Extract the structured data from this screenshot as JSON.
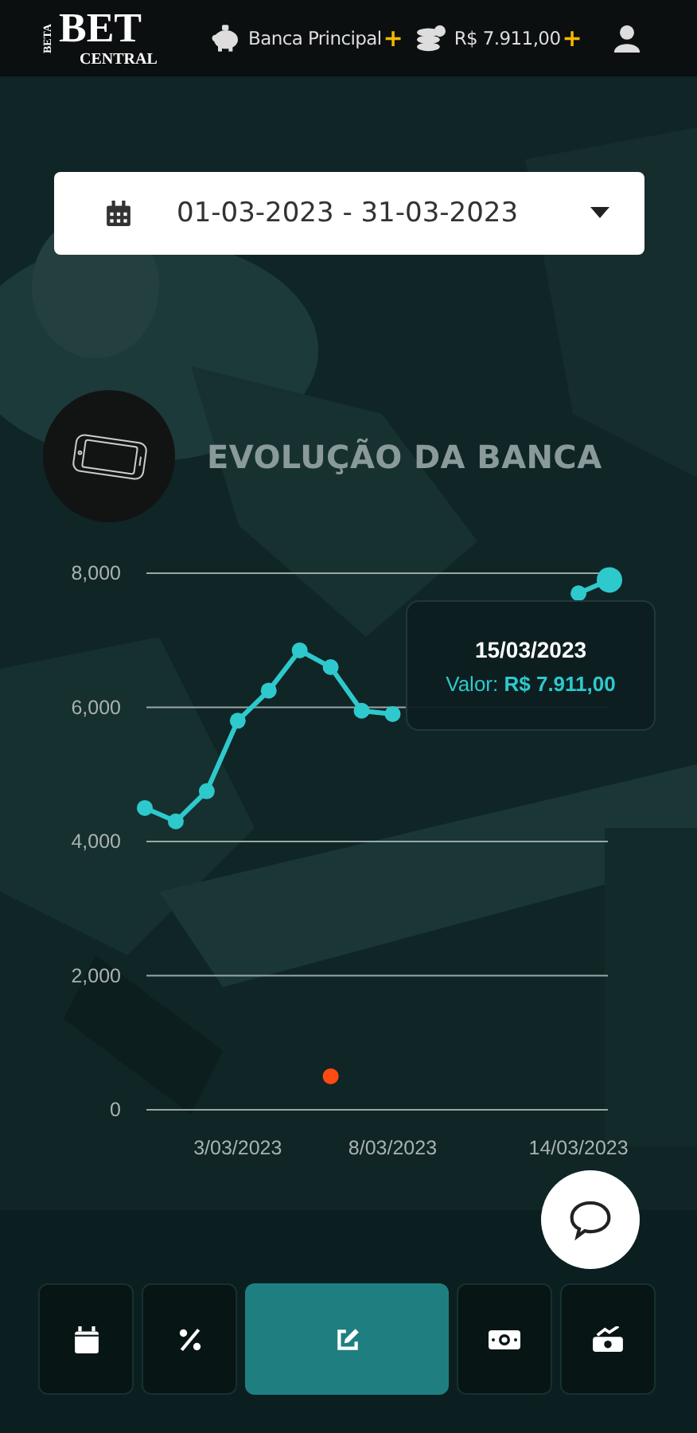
{
  "header": {
    "logo": {
      "small": "BETA",
      "main": "BET",
      "sub": "CENTRAL"
    },
    "bank": "Banca Principal",
    "bank_add": "+",
    "balance": "R$ 7.911,00",
    "balance_add": "+"
  },
  "date_range": {
    "value": "01-03-2023 - 31-03-2023"
  },
  "section_title": "EVOLUÇÃO DA BANCA",
  "chart": {
    "chart_data": {
      "type": "line",
      "categories": [
        null,
        null,
        null,
        "3/03/2023",
        null,
        null,
        null,
        null,
        "8/03/2023",
        null,
        null,
        null,
        null,
        null,
        "14/03/2023",
        null
      ],
      "grid": true,
      "series": [
        {
          "color": "#2ec9cc",
          "marker": true,
          "values": [
            4500,
            4300,
            4750,
            5800,
            6250,
            6850,
            6600,
            5950,
            5900,
            null,
            null,
            null,
            null,
            null,
            7700,
            7900
          ]
        },
        {
          "color": "#ff4a12",
          "marker": true,
          "values": [
            null,
            null,
            null,
            null,
            null,
            null,
            500,
            null,
            null,
            null,
            null,
            null,
            null,
            null,
            null,
            null
          ]
        }
      ],
      "ylim": [
        0,
        8000
      ],
      "yticks": [
        {
          "value": 0,
          "label": "0"
        },
        {
          "value": 2000,
          "label": "2,000"
        },
        {
          "value": 4000,
          "label": "4,000"
        },
        {
          "value": 6000,
          "label": "6,000"
        },
        {
          "value": 8000,
          "label": "8,000"
        }
      ]
    },
    "tooltip": {
      "title": "15/03/2023",
      "label": "Valor:",
      "value": "R$ 7.911,00"
    }
  },
  "nav": [
    {
      "selected": false
    },
    {
      "selected": false
    },
    {
      "selected": true
    },
    {
      "selected": false
    },
    {
      "selected": false
    }
  ]
}
